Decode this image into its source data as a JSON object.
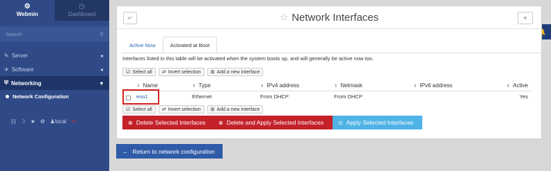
{
  "sidebar": {
    "tabs": [
      {
        "label": "Webmin",
        "icon": "webmin-icon"
      },
      {
        "label": "Dashboard",
        "icon": "dashboard-icon"
      }
    ],
    "search_placeholder": "Search",
    "items": [
      {
        "label": "Server"
      },
      {
        "label": "Software"
      },
      {
        "label": "Networking"
      }
    ],
    "sub_item": "Network Configuration",
    "bottom_user": "local"
  },
  "header": {
    "title": "Network Interfaces"
  },
  "tabs": [
    {
      "label": "Active Now"
    },
    {
      "label": "Activated at Boot"
    }
  ],
  "description": "Interfaces listed in this table will be activated when the system boots up, and will generally be active now too.",
  "toolbar": {
    "select_all": "Select all",
    "invert_selection": "Invert selection",
    "add_interface": "Add a new interface"
  },
  "table": {
    "columns": [
      "Name",
      "Type",
      "IPv4 address",
      "Netmask",
      "IPv6 address",
      "Active"
    ],
    "rows": [
      {
        "name": "eno1",
        "type": "Ethernet",
        "ipv4": "From DHCP",
        "netmask": "From DHCP",
        "ipv6": "",
        "active": "Yes"
      }
    ]
  },
  "actions": {
    "delete_selected": "Delete Selected Interfaces",
    "delete_apply": "Delete and Apply Selected Interfaces",
    "apply_selected": "Apply Selected Interfaces"
  },
  "return_button": "Return to network configuration",
  "colors": {
    "sidebar": "#2f4a86",
    "danger": "#c4212a",
    "info": "#4fb3e6",
    "primary": "#2f5ba8"
  }
}
